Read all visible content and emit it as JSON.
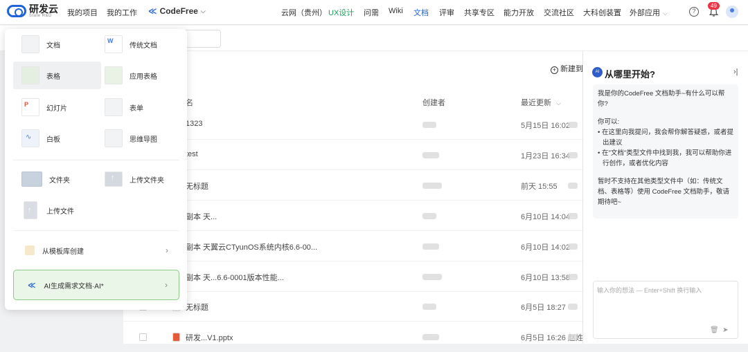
{
  "header": {
    "logo_text": "研发云",
    "logo_sub": "State R&D",
    "left_nav": [
      "我的项目",
      "我的工作"
    ],
    "codefree_label": "CodeFree",
    "right_nav": [
      {
        "label": "云网（贵州）",
        "state": "normal"
      },
      {
        "label": "UX设计",
        "state": "green"
      },
      {
        "label": "问需",
        "state": "normal"
      },
      {
        "label": "Wiki",
        "state": "normal"
      },
      {
        "label": "文档",
        "state": "active"
      },
      {
        "label": "评审",
        "state": "normal"
      },
      {
        "label": "共享专区",
        "state": "normal"
      },
      {
        "label": "能力开放",
        "state": "normal"
      },
      {
        "label": "交流社区",
        "state": "normal"
      },
      {
        "label": "大科创装置",
        "state": "normal"
      },
      {
        "label": "外部应用",
        "state": "dropdown"
      }
    ],
    "help_icon": "?",
    "notification_count": "49"
  },
  "toolbar": {
    "new_button": "新建到"
  },
  "table": {
    "columns": [
      "名",
      "创建者",
      "最近更新"
    ],
    "rows": [
      {
        "name": "1323",
        "updated": "5月15日 16:02"
      },
      {
        "name": "test",
        "updated": "1月23日 16:34"
      },
      {
        "name": "无标题",
        "updated": "前天 15:55"
      },
      {
        "name": "副本 天...",
        "updated": "6月10日 14:04"
      },
      {
        "name": "副本 天翼云CTyunOS系统内核6.6-00...",
        "updated": "6月10日 14:02"
      },
      {
        "name": "副本 天...6.6-0001版本性能...",
        "updated": "6月10日 13:58"
      },
      {
        "name": "无标题",
        "updated": "6月5日 18:27"
      },
      {
        "name": "研发...V1.pptx",
        "updated": "6月5日 16:26 赵姓"
      }
    ]
  },
  "create_menu": {
    "items": [
      {
        "label": "文档",
        "icon": "doc-icon"
      },
      {
        "label": "传统文档",
        "icon": "word-icon"
      },
      {
        "label": "表格",
        "icon": "sheet-icon"
      },
      {
        "label": "应用表格",
        "icon": "app-sheet-icon"
      },
      {
        "label": "幻灯片",
        "icon": "slides-icon"
      },
      {
        "label": "表单",
        "icon": "form-icon"
      },
      {
        "label": "白板",
        "icon": "whiteboard-icon"
      },
      {
        "label": "思维导图",
        "icon": "mindmap-icon"
      },
      {
        "label": "文件夹",
        "icon": "folder-icon"
      },
      {
        "label": "上传文件夹",
        "icon": "upload-folder-icon"
      },
      {
        "label": "上传文件",
        "icon": "upload-file-icon"
      }
    ],
    "template_label": "从模板库创建",
    "ai_label": "AI生成需求文档·AI*"
  },
  "assistant": {
    "title": "从哪里开始?",
    "intro": "我是你的CodeFree 文档助手~有什么可以帮你?",
    "can_label": "你可以:",
    "bullets": [
      "在这里向我提问，我会帮你解答疑惑，或者提出建议",
      "在\"文档\"类型文件中找到我，我可以帮助你进行创作，或者优化内容"
    ],
    "note": "暂时不支持在其他类型文件中（如：传统文档、表格等）使用 CodeFree 文档助手，敬请期待吧~",
    "input_placeholder": "输入你的想法 — Enter+Shift 换行输入"
  },
  "colors": {
    "accent": "#1f63d6",
    "ai_green": "#1aa35a",
    "badge": "#e33344"
  }
}
